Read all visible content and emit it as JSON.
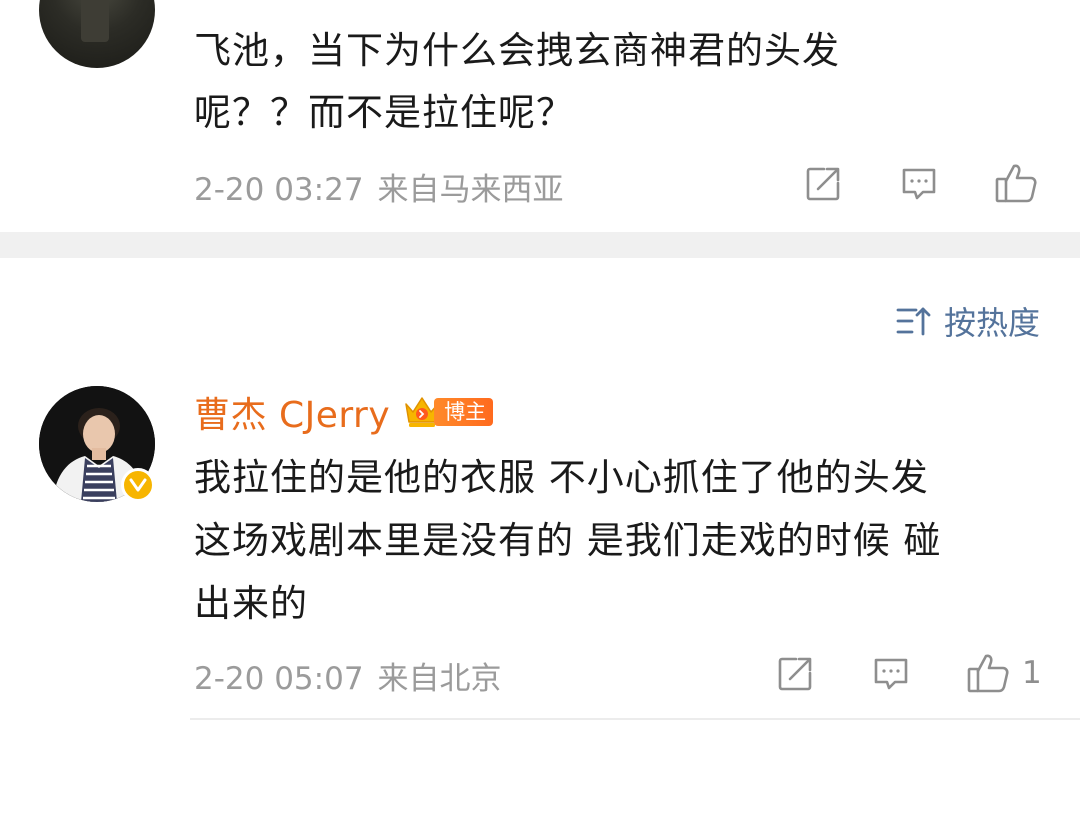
{
  "comment_top": {
    "text_lines": [
      "飞池，当下为什么会拽玄商神君的头发",
      "呢？？而不是拉住呢？"
    ],
    "time": "2-20 03:27",
    "source": "来自马来西亚",
    "actions": {
      "repost_icon": "repost-icon",
      "reply_icon": "comment-icon",
      "like_icon": "thumbs-up-icon"
    }
  },
  "sort": {
    "icon": "sort-icon",
    "label": "按热度"
  },
  "comment_reply": {
    "username": "曹杰 CJerry",
    "badge_label": "博主",
    "verified_icon": "verified-v-icon",
    "text_lines": [
      "我拉住的是他的衣服 不小心抓住了他的头发",
      "这场戏剧本里是没有的 是我们走戏的时候 碰",
      "出来的"
    ],
    "time": "2-20 05:07",
    "source": "来自北京",
    "like_count": "1",
    "actions": {
      "repost_icon": "repost-icon",
      "reply_icon": "comment-icon",
      "like_icon": "thumbs-up-icon"
    }
  },
  "colors": {
    "username": "#e86c1c",
    "sort_link": "#54739b",
    "meta_text": "#9b9b9b",
    "body_text": "#1a1a1a",
    "separator": "#f0f0f0",
    "verified": "#f7b500"
  }
}
